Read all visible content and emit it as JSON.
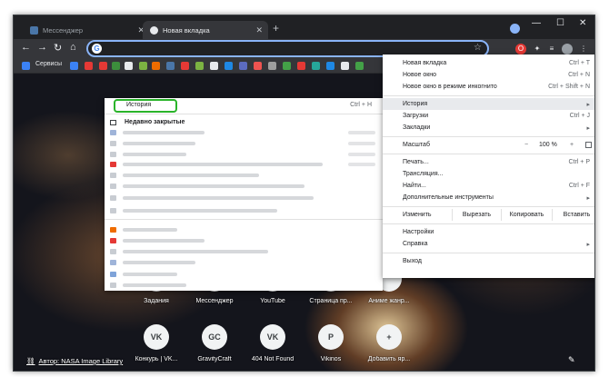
{
  "tabs": [
    {
      "label": "Мессенджер",
      "active": false,
      "favicon_color": "#4a76a8"
    },
    {
      "label": "Новая вкладка",
      "active": true,
      "favicon_color": "#e8eaed"
    }
  ],
  "toolbar": {
    "address_value": "",
    "extension_icons": [
      {
        "name": "opera-icon",
        "color": "#e53935"
      },
      {
        "name": "puzzle-icon",
        "color": "#35363a"
      },
      {
        "name": "playlist-icon",
        "color": "#35363a"
      },
      {
        "name": "profile-avatar",
        "color": "#9aa0a6"
      }
    ]
  },
  "bookmarks": {
    "services_label": "Сервисы",
    "icon_colors": [
      "#3b82f6",
      "#e53935",
      "#e53935",
      "#3c8e3c",
      "#e8eaed",
      "#7cb342",
      "#ef6c00",
      "#4a76a8",
      "#e53935",
      "#7cb342",
      "#e8eaed",
      "#1e88e5",
      "#5c6bc0",
      "#ef5350",
      "#9e9e9e",
      "#43a047",
      "#e53935",
      "#26a69a",
      "#1e88e5",
      "#e8eaed",
      "#43a047"
    ]
  },
  "ntp": {
    "row1": [
      {
        "label": "Задания",
        "glyph": ""
      },
      {
        "label": "Мессенджер",
        "glyph": ""
      },
      {
        "label": "YouTube",
        "glyph": ""
      },
      {
        "label": "Страница пр...",
        "glyph": ""
      },
      {
        "label": "Аниме жанр...",
        "glyph": ""
      }
    ],
    "row2": [
      {
        "label": "Конкурь | VK...",
        "glyph": "VK"
      },
      {
        "label": "GravityCraft",
        "glyph": "GC"
      },
      {
        "label": "404 Not Found",
        "glyph": "VK"
      },
      {
        "label": "Vikinos",
        "glyph": "P"
      },
      {
        "label": "Добавить яр...",
        "glyph": "+"
      }
    ],
    "credit": "Автор: NASA Image Library"
  },
  "history_submenu": {
    "history_label": "История",
    "history_shortcut": "Ctrl + H",
    "recent_label": "Недавно закрытые",
    "highlight_color": "#2ab42a"
  },
  "menu": {
    "new_tab": "Новая вкладка",
    "new_tab_sc": "Ctrl + T",
    "new_window": "Новое окно",
    "new_window_sc": "Ctrl + N",
    "incognito": "Новое окно в режиме инкогнито",
    "incognito_sc": "Ctrl + Shift + N",
    "history": "История",
    "downloads": "Загрузки",
    "downloads_sc": "Ctrl + J",
    "bookmarks": "Закладки",
    "zoom": "Масштаб",
    "zoom_minus": "−",
    "zoom_value": "100 %",
    "zoom_plus": "+",
    "print": "Печать...",
    "print_sc": "Ctrl + P",
    "cast": "Трансляция...",
    "find": "Найти...",
    "find_sc": "Ctrl + F",
    "more_tools": "Дополнительные инструменты",
    "edit": "Изменить",
    "cut": "Вырезать",
    "copy": "Копировать",
    "paste": "Вставить",
    "settings": "Настройки",
    "help": "Справка",
    "exit": "Выход",
    "arrow": "▸"
  }
}
